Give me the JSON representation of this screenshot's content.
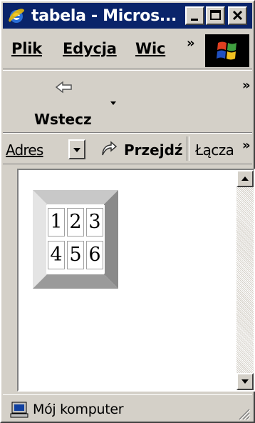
{
  "window": {
    "title": "tabela - Micros..."
  },
  "menu": {
    "items": [
      "Plik",
      "Edycja",
      "Wic"
    ],
    "more": "»"
  },
  "toolbar": {
    "back_label": "Wstecz",
    "more": "»"
  },
  "address": {
    "label": "Adres",
    "go_label": "Przejdź",
    "links_label": "Łącza",
    "links_more": "»"
  },
  "table": {
    "rows": [
      [
        "1",
        "2",
        "3"
      ],
      [
        "4",
        "5",
        "6"
      ]
    ]
  },
  "status": {
    "text": "Mój komputer"
  },
  "colors": {
    "titlebar": "#0a246a",
    "chrome": "#d4d0c8"
  }
}
